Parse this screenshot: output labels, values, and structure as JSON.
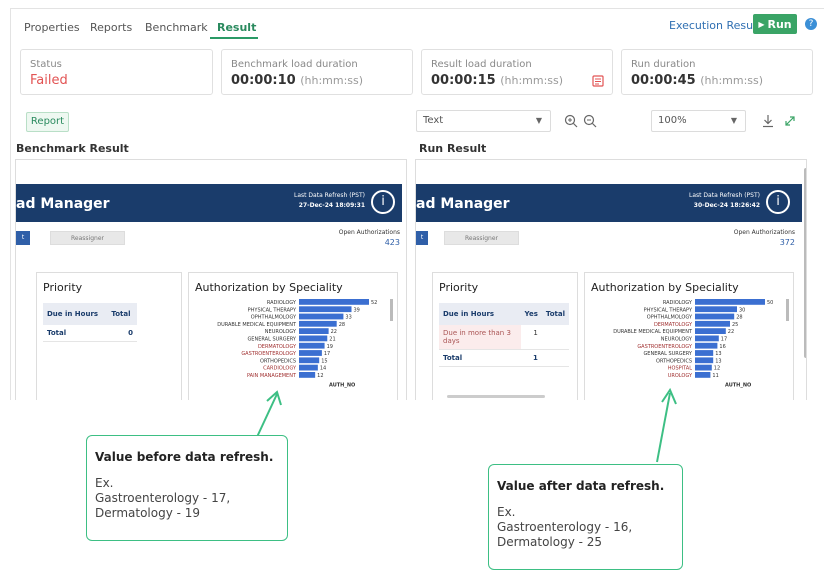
{
  "tabs": [
    {
      "label": "Properties"
    },
    {
      "label": "Reports"
    },
    {
      "label": "Benchmark"
    },
    {
      "label": "Result",
      "active": true
    }
  ],
  "header": {
    "execution_results": "Execution Results",
    "run_label": "Run",
    "help": "?"
  },
  "status_cards": [
    {
      "label": "Status",
      "value": "Failed"
    },
    {
      "label": "Benchmark load duration",
      "value": "00:00:10",
      "unit": "(hh:mm:ss)"
    },
    {
      "label": "Result load duration",
      "value": "00:00:15",
      "unit": "(hh:mm:ss)"
    },
    {
      "label": "Run duration",
      "value": "00:00:45",
      "unit": "(hh:mm:ss)"
    }
  ],
  "toolbar": {
    "report_button": "Report",
    "view_select": "Text",
    "zoom_value": "100%"
  },
  "benchmark": {
    "section_title": "Benchmark Result",
    "banner_title": "ad Manager",
    "refresh_label": "Last Data Refresh (PST)",
    "refresh_value": "27-Dec-24 18:09:31",
    "info": "i",
    "chip_left": "t",
    "chip_reassign": "Reassigner",
    "open_auth_label": "Open Authorizations",
    "open_auth_value": "423",
    "priority": {
      "title": "Priority",
      "h1": "Due in Hours",
      "h2": "Total",
      "row_label": "Total",
      "row_value": "0"
    },
    "chart_title": "Authorization by Speciality",
    "axis_label": "AUTH_NO"
  },
  "run": {
    "section_title": "Run Result",
    "banner_title": "ad Manager",
    "refresh_label": "Last Data Refresh (PST)",
    "refresh_value": "30-Dec-24 18:26:42",
    "info": "i",
    "chip_left": "t",
    "chip_reassign": "Reassigner",
    "open_auth_label": "Open Authorizations",
    "open_auth_value": "372",
    "priority": {
      "title": "Priority",
      "h1": "Due in Hours",
      "h2": "Yes",
      "h3": "Total",
      "r1_label": "Due in more than 3 days",
      "r1_yes": "1",
      "r2_label": "Total",
      "r2_yes": "1"
    },
    "chart_title": "Authorization by Speciality",
    "axis_label": "AUTH_NO"
  },
  "chart_data": [
    {
      "type": "bar",
      "title": "Authorization by Speciality",
      "xlabel": "AUTH_NO",
      "categories": [
        "RADIOLOGY",
        "PHYSICAL THERAPY",
        "OPHTHALMOLOGY",
        "DURABLE MEDICAL EQUIPMENT",
        "NEUROLOGY",
        "GENERAL SURGERY",
        "DERMATOLOGY",
        "GASTROENTEROLOGY",
        "ORTHOPEDICS",
        "CARDIOLOGY",
        "PAIN MANAGEMENT"
      ],
      "values": [
        52,
        39,
        33,
        28,
        22,
        21,
        19,
        17,
        15,
        14,
        12
      ],
      "highlighted": [
        "DERMATOLOGY",
        "GASTROENTEROLOGY",
        "CARDIOLOGY",
        "PAIN MANAGEMENT"
      ],
      "xlim": [
        0,
        52
      ]
    },
    {
      "type": "bar",
      "title": "Authorization by Speciality",
      "xlabel": "AUTH_NO",
      "categories": [
        "RADIOLOGY",
        "PHYSICAL THERAPY",
        "OPHTHALMOLOGY",
        "DERMATOLOGY",
        "DURABLE MEDICAL EQUIPMENT",
        "NEUROLOGY",
        "GASTROENTEROLOGY",
        "GENERAL SURGERY",
        "ORTHOPEDICS",
        "HOSPITAL",
        "UROLOGY"
      ],
      "values": [
        50,
        30,
        28,
        25,
        22,
        17,
        16,
        13,
        13,
        12,
        11
      ],
      "highlighted": [
        "DERMATOLOGY",
        "GASTROENTEROLOGY",
        "HOSPITAL",
        "UROLOGY"
      ],
      "xlim": [
        0,
        50
      ]
    }
  ],
  "callouts": [
    {
      "title": "Value before data refresh.",
      "body": "Ex.\nGastroenterology - 17,\nDermatology - 19"
    },
    {
      "title": "Value after data refresh.",
      "body": "Ex.\nGastroenterology - 16,\nDermatology - 25"
    }
  ],
  "colors": {
    "accent": "#2a9a66",
    "bar": "#3b6fd1",
    "banner": "#1a3c6b",
    "failed": "#e25353",
    "callout": "#3dbf84"
  }
}
